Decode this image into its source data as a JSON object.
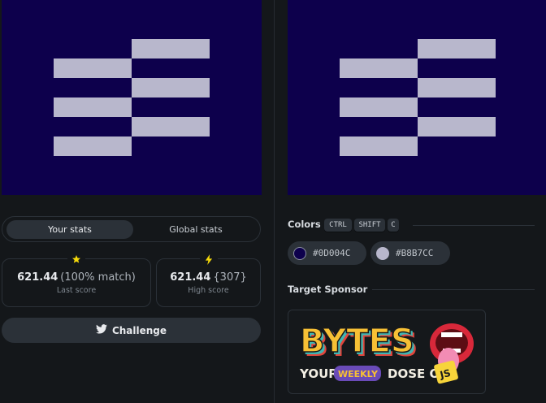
{
  "colors": {
    "background": "#0D004C",
    "foreground": "#B8B7CC",
    "star": "#f5d90a",
    "bolt": "#f5d90a"
  },
  "stats_toggle": {
    "your_stats": "Your stats",
    "global_stats": "Global stats"
  },
  "last_score": {
    "value": "621.44",
    "match": "(100% match)",
    "label": "Last score",
    "icon": "star-icon"
  },
  "high_score": {
    "value": "621.44",
    "extra": "{307}",
    "label": "High score",
    "icon": "bolt-icon"
  },
  "challenge": {
    "label": "Challenge",
    "icon": "twitter-icon"
  },
  "colors_section": {
    "title": "Colors",
    "shortcut": [
      "CTRL",
      "SHIFT",
      "C"
    ],
    "swatches": [
      {
        "hex": "#0D004C",
        "color": "#0D004C"
      },
      {
        "hex": "#B8B7CC",
        "color": "#B8B7CC"
      }
    ]
  },
  "sponsor": {
    "title": "Target Sponsor",
    "logo_text": "BYTES",
    "line_your": "YOUR",
    "line_weekly": "WEEKLY",
    "line_dose": "DOSE OF",
    "badge": "JS"
  }
}
